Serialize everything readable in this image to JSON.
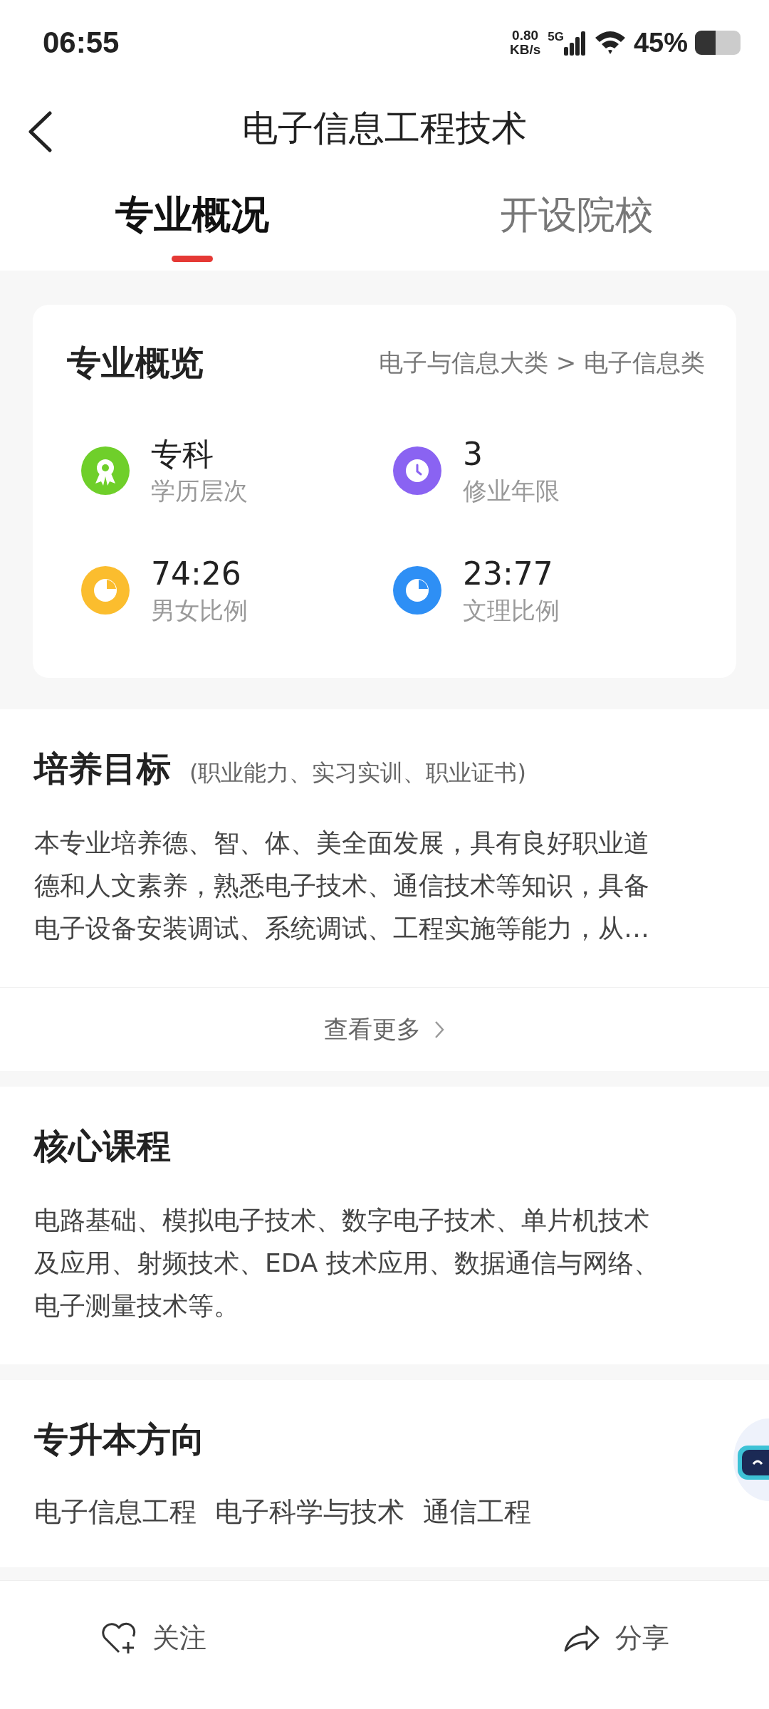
{
  "status_bar": {
    "time": "06:55",
    "net_speed": "0.80",
    "net_unit": "KB/s",
    "network": "5G",
    "battery": "45%"
  },
  "header": {
    "title": "电子信息工程技术"
  },
  "tabs": [
    {
      "label": "专业概况",
      "selected": true
    },
    {
      "label": "开设院校",
      "selected": false
    }
  ],
  "overview": {
    "title": "专业概览",
    "category": "电子与信息大类 > 电子信息类",
    "stats": [
      {
        "kind": "award",
        "value": "专科",
        "label": "学历层次",
        "color": "#6fcf2a"
      },
      {
        "kind": "clock",
        "value": "3",
        "label": "修业年限",
        "color": "#8a63f2"
      },
      {
        "kind": "pie",
        "value": "74:26",
        "label": "男女比例",
        "color": "#fbbd2e"
      },
      {
        "kind": "pie",
        "value": "23:77",
        "label": "文理比例",
        "color": "#2e8ff5"
      }
    ]
  },
  "goal": {
    "title": "培养目标",
    "subtitle": "(职业能力、实习实训、职业证书)",
    "lines": [
      "本专业培养德、智、体、美全面发展，具有良好职业道",
      "德和人文素养，熟悉电子技术、通信技术等知识，具备",
      "电子设备安装调试、系统调试、工程实施等能力，从…"
    ],
    "more": "查看更多"
  },
  "courses": {
    "title": "核心课程",
    "lines": [
      "电路基础、模拟电子技术、数字电子技术、单片机技术",
      "及应用、射频技术、EDA 技术应用、数据通信与网络、",
      "电子测量技术等。"
    ]
  },
  "upgrade": {
    "title": "专升本方向",
    "items": [
      "电子信息工程",
      "电子科学与技术",
      "通信工程"
    ]
  },
  "bottom_bar": {
    "follow": "关注",
    "share": "分享"
  }
}
